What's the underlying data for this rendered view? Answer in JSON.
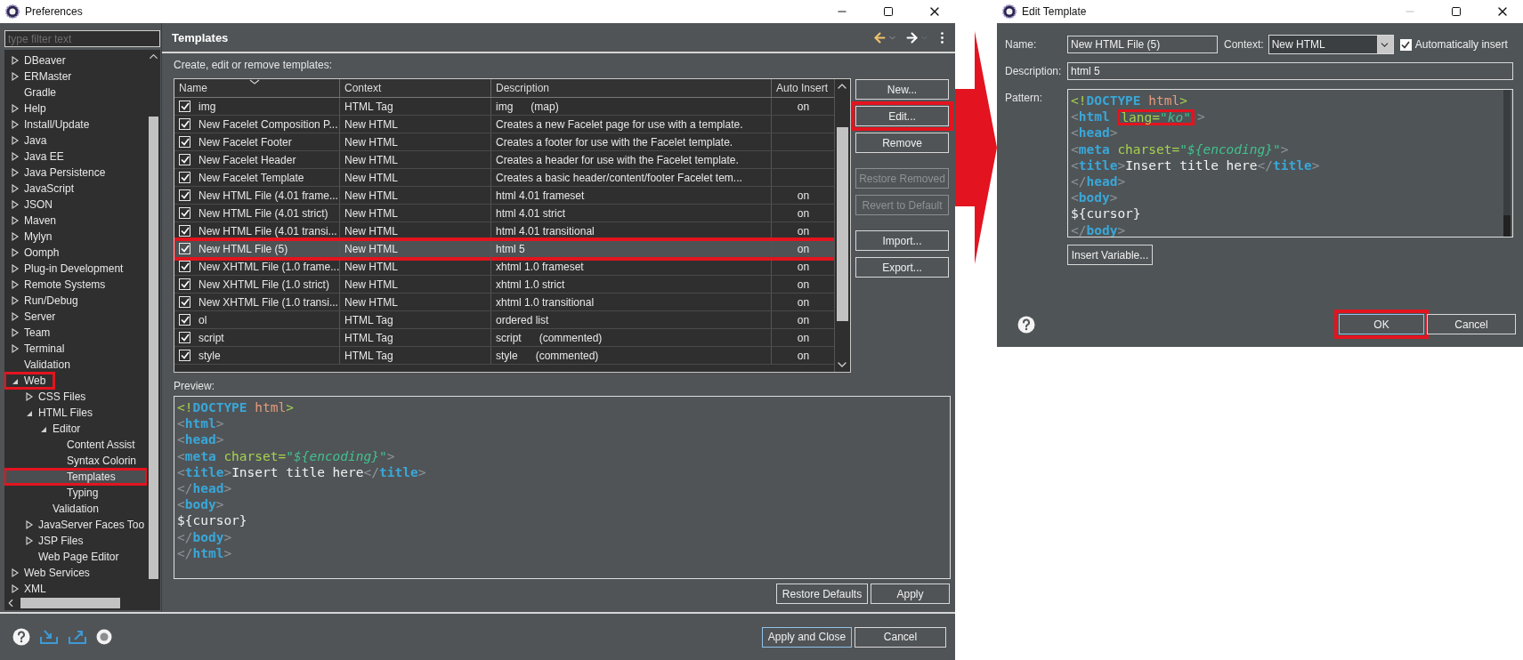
{
  "preferences": {
    "title": "Preferences",
    "filter": {
      "placeholder": "type filter text"
    },
    "tree": [
      {
        "label": "DBeaver",
        "expanded": false,
        "selected": false
      },
      {
        "label": "ERMaster",
        "expanded": false,
        "selected": false
      },
      {
        "label": "Gradle",
        "selected": false
      },
      {
        "label": "Help",
        "expanded": false,
        "selected": false
      },
      {
        "label": "Install/Update",
        "expanded": false,
        "selected": false
      },
      {
        "label": "Java",
        "expanded": false,
        "selected": false
      },
      {
        "label": "Java EE",
        "expanded": false,
        "selected": false
      },
      {
        "label": "Java Persistence",
        "expanded": false,
        "selected": false
      },
      {
        "label": "JavaScript",
        "expanded": false,
        "selected": false
      },
      {
        "label": "JSON",
        "expanded": false,
        "selected": false
      },
      {
        "label": "Maven",
        "expanded": false,
        "selected": false
      },
      {
        "label": "Mylyn",
        "expanded": false,
        "selected": false
      },
      {
        "label": "Oomph",
        "expanded": false,
        "selected": false
      },
      {
        "label": "Plug-in Development",
        "expanded": false,
        "selected": false
      },
      {
        "label": "Remote Systems",
        "expanded": false,
        "selected": false
      },
      {
        "label": "Run/Debug",
        "expanded": false,
        "selected": false
      },
      {
        "label": "Server",
        "expanded": false,
        "selected": false
      },
      {
        "label": "Team",
        "expanded": false,
        "selected": false
      },
      {
        "label": "Terminal",
        "expanded": false,
        "selected": false
      },
      {
        "label": "Validation",
        "selected": false
      },
      {
        "label": "Web",
        "expanded": true,
        "selected": false,
        "highlighted": true,
        "children": [
          {
            "label": "CSS Files",
            "expanded": false,
            "selected": false
          },
          {
            "label": "HTML Files",
            "expanded": true,
            "selected": false,
            "children": [
              {
                "label": "Editor",
                "expanded": true,
                "selected": false,
                "children": [
                  {
                    "label": "Content Assist",
                    "selected": false
                  },
                  {
                    "label": "Syntax Colorin",
                    "selected": false
                  },
                  {
                    "label": "Templates",
                    "selected": true,
                    "highlighted": true
                  },
                  {
                    "label": "Typing",
                    "selected": false
                  }
                ]
              },
              {
                "label": "Validation",
                "selected": false
              }
            ]
          },
          {
            "label": "JavaServer Faces Too",
            "expanded": false,
            "selected": false
          },
          {
            "label": "JSP Files",
            "expanded": false,
            "selected": false
          },
          {
            "label": "Web Page Editor",
            "selected": false
          }
        ]
      },
      {
        "label": "Web Services",
        "expanded": false,
        "selected": false
      },
      {
        "label": "XML",
        "expanded": false,
        "selected": false
      }
    ],
    "page": {
      "title": "Templates",
      "subtitle": "Create, edit or remove templates:",
      "table": {
        "columns": [
          "Name",
          "Context",
          "Description",
          "Auto Insert"
        ],
        "rows": [
          {
            "checked": true,
            "name": "img",
            "context": "HTML Tag",
            "description": "img      (map)",
            "auto_insert": "on",
            "selected": false
          },
          {
            "checked": true,
            "name": "New Facelet Composition P...",
            "context": "New HTML",
            "description": "Creates a new Facelet page for use with a template.",
            "selected": false
          },
          {
            "checked": true,
            "name": "New Facelet Footer",
            "context": "New HTML",
            "description": "Creates a footer for use with the Facelet template.",
            "selected": false
          },
          {
            "checked": true,
            "name": "New Facelet Header",
            "context": "New HTML",
            "description": "Creates a header for use with the Facelet template.",
            "selected": false
          },
          {
            "checked": true,
            "name": "New Facelet Template",
            "context": "New HTML",
            "description": "Creates a basic header/content/footer Facelet tem...",
            "selected": false
          },
          {
            "checked": true,
            "name": "New HTML File (4.01 frame...",
            "context": "New HTML",
            "description": "html 4.01 frameset",
            "auto_insert": "on",
            "selected": false
          },
          {
            "checked": true,
            "name": "New HTML File (4.01 strict)",
            "context": "New HTML",
            "description": "html 4.01 strict",
            "auto_insert": "on",
            "selected": false
          },
          {
            "checked": true,
            "name": "New HTML File (4.01 transi...",
            "context": "New HTML",
            "description": "html 4.01 transitional",
            "auto_insert": "on",
            "selected": false
          },
          {
            "checked": true,
            "name": "New HTML File (5)",
            "context": "New HTML",
            "description": "html 5",
            "auto_insert": "on",
            "selected": true,
            "highlighted": true
          },
          {
            "checked": true,
            "name": "New XHTML File (1.0 frame...",
            "context": "New HTML",
            "description": "xhtml 1.0 frameset",
            "auto_insert": "on",
            "selected": false
          },
          {
            "checked": true,
            "name": "New XHTML File (1.0 strict)",
            "context": "New HTML",
            "description": "xhtml 1.0 strict",
            "auto_insert": "on",
            "selected": false
          },
          {
            "checked": true,
            "name": "New XHTML File (1.0 transi...",
            "context": "New HTML",
            "description": "xhtml 1.0 transitional",
            "auto_insert": "on",
            "selected": false
          },
          {
            "checked": true,
            "name": "ol",
            "context": "HTML Tag",
            "description": "ordered list",
            "auto_insert": "on",
            "selected": false
          },
          {
            "checked": true,
            "name": "script",
            "context": "HTML Tag",
            "description": "script      (commented)",
            "auto_insert": "on",
            "selected": false
          },
          {
            "checked": true,
            "name": "style",
            "context": "HTML Tag",
            "description": "style      (commented)",
            "auto_insert": "on",
            "selected": false
          }
        ]
      },
      "button_groups": [
        [
          {
            "label": "New...",
            "disabled": false
          },
          {
            "label": "Edit...",
            "disabled": false,
            "highlighted": true
          },
          {
            "label": "Remove",
            "disabled": false
          }
        ],
        [
          {
            "label": "Restore Removed",
            "disabled": true
          },
          {
            "label": "Revert to Default",
            "disabled": true
          }
        ],
        [
          {
            "label": "Import...",
            "disabled": false
          },
          {
            "label": "Export...",
            "disabled": false
          }
        ]
      ],
      "preview": {
        "label": "Preview:",
        "lines": [
          {
            "tokens": [
              {
                "kind": "decl",
                "text": "<!"
              },
              {
                "kind": "tag",
                "text": "DOCTYPE "
              },
              {
                "kind": "name",
                "text": "html"
              },
              {
                "kind": "decl",
                "text": ">"
              }
            ]
          },
          {
            "tokens": [
              {
                "kind": "punct",
                "text": "<"
              },
              {
                "kind": "tag",
                "text": "html"
              },
              {
                "kind": "punct",
                "text": ">"
              }
            ]
          },
          {
            "tokens": [
              {
                "kind": "punct",
                "text": "<"
              },
              {
                "kind": "tag",
                "text": "head"
              },
              {
                "kind": "punct",
                "text": ">"
              }
            ]
          },
          {
            "tokens": [
              {
                "kind": "punct",
                "text": "<"
              },
              {
                "kind": "tag",
                "text": "meta "
              },
              {
                "kind": "attr",
                "text": "charset="
              },
              {
                "kind": "value",
                "text": "\"${encoding}\""
              },
              {
                "kind": "punct",
                "text": ">"
              }
            ]
          },
          {
            "tokens": [
              {
                "kind": "punct",
                "text": "<"
              },
              {
                "kind": "tag",
                "text": "title"
              },
              {
                "kind": "punct",
                "text": ">"
              },
              {
                "kind": "text",
                "text": "Insert title here"
              },
              {
                "kind": "punct",
                "text": "</"
              },
              {
                "kind": "tag",
                "text": "title"
              },
              {
                "kind": "punct",
                "text": ">"
              }
            ]
          },
          {
            "tokens": [
              {
                "kind": "punct",
                "text": "</"
              },
              {
                "kind": "tag",
                "text": "head"
              },
              {
                "kind": "punct",
                "text": ">"
              }
            ]
          },
          {
            "tokens": [
              {
                "kind": "punct",
                "text": "<"
              },
              {
                "kind": "tag",
                "text": "body"
              },
              {
                "kind": "punct",
                "text": ">"
              }
            ]
          },
          {
            "tokens": [
              {
                "kind": "text",
                "text": "${cursor}"
              }
            ]
          },
          {
            "tokens": [
              {
                "kind": "punct",
                "text": "</"
              },
              {
                "kind": "tag",
                "text": "body"
              },
              {
                "kind": "punct",
                "text": ">"
              }
            ]
          },
          {
            "tokens": [
              {
                "kind": "punct",
                "text": "</"
              },
              {
                "kind": "tag",
                "text": "html"
              },
              {
                "kind": "punct",
                "text": ">"
              }
            ]
          }
        ]
      },
      "page_buttons": [
        "Restore Defaults",
        "Apply"
      ]
    },
    "footer_buttons": [
      {
        "label": "Apply and Close",
        "default": true
      },
      {
        "label": "Cancel",
        "default": false
      }
    ]
  },
  "edit_template": {
    "title": "Edit Template",
    "name": {
      "label": "Name:",
      "value": "New HTML File (5)"
    },
    "context": {
      "label": "Context:",
      "value": "New HTML"
    },
    "auto_insert": {
      "label": "Automatically insert",
      "checked": true
    },
    "description": {
      "label": "Description:",
      "value": "html 5"
    },
    "pattern": {
      "label": "Pattern:",
      "lines": [
        {
          "tokens": [
            {
              "kind": "decl",
              "text": "<!"
            },
            {
              "kind": "tag",
              "text": "DOCTYPE "
            },
            {
              "kind": "name",
              "text": "html"
            },
            {
              "kind": "decl",
              "text": ">"
            }
          ]
        },
        {
          "tokens": [
            {
              "kind": "punct",
              "text": "<"
            },
            {
              "kind": "tag",
              "text": "html "
            },
            {
              "kind": "attr",
              "text": "lang=",
              "highlighted": true
            },
            {
              "kind": "value",
              "text": "\"ko\"",
              "highlighted": true
            },
            {
              "kind": "punct",
              "text": ">"
            }
          ]
        },
        {
          "tokens": [
            {
              "kind": "punct",
              "text": "<"
            },
            {
              "kind": "tag",
              "text": "head"
            },
            {
              "kind": "punct",
              "text": ">"
            }
          ]
        },
        {
          "tokens": [
            {
              "kind": "punct",
              "text": "<"
            },
            {
              "kind": "tag",
              "text": "meta "
            },
            {
              "kind": "attr",
              "text": "charset="
            },
            {
              "kind": "value",
              "text": "\"${encoding}\""
            },
            {
              "kind": "punct",
              "text": ">"
            }
          ]
        },
        {
          "tokens": [
            {
              "kind": "punct",
              "text": "<"
            },
            {
              "kind": "tag",
              "text": "title"
            },
            {
              "kind": "punct",
              "text": ">"
            },
            {
              "kind": "text",
              "text": "Insert title here"
            },
            {
              "kind": "punct",
              "text": "</"
            },
            {
              "kind": "tag",
              "text": "title"
            },
            {
              "kind": "punct",
              "text": ">"
            }
          ]
        },
        {
          "tokens": [
            {
              "kind": "punct",
              "text": "</"
            },
            {
              "kind": "tag",
              "text": "head"
            },
            {
              "kind": "punct",
              "text": ">"
            }
          ]
        },
        {
          "tokens": [
            {
              "kind": "punct",
              "text": "<"
            },
            {
              "kind": "tag",
              "text": "body"
            },
            {
              "kind": "punct",
              "text": ">"
            }
          ]
        },
        {
          "tokens": [
            {
              "kind": "text",
              "text": "${cursor}"
            }
          ]
        },
        {
          "tokens": [
            {
              "kind": "punct",
              "text": "</"
            },
            {
              "kind": "tag",
              "text": "body"
            },
            {
              "kind": "punct",
              "text": ">"
            }
          ]
        }
      ]
    },
    "insert_variable": "Insert Variable...",
    "buttons": [
      {
        "label": "OK",
        "default": true,
        "highlighted": true
      },
      {
        "label": "Cancel",
        "default": false
      }
    ]
  }
}
